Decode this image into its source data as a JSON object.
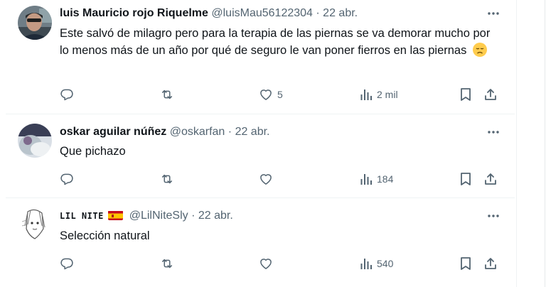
{
  "colors": {
    "text": "#0f1419",
    "secondary": "#536471",
    "divider": "#eff3f4",
    "background": "#ffffff"
  },
  "tweets": [
    {
      "name": "luis Mauricio rojo Riquelme",
      "handle": "@luisMau56122304",
      "separator": "·",
      "date": "22 abr.",
      "text": "Este salvó de milagro pero para la terapia de las piernas se va demorar mucho por lo menos más de un año por qué de seguro le van poner fierros en las piernas",
      "emoji": "disappointed-face",
      "likes": "5",
      "views": "2 mil"
    },
    {
      "name": "oskar aguilar núñez",
      "handle": "@oskarfan",
      "separator": "·",
      "date": "22 abr.",
      "text": "Que pichazo",
      "likes": "",
      "views": "184"
    },
    {
      "name": "LIL NITE",
      "flag": "spain-flag",
      "handle": "@LilNiteSly",
      "separator": "·",
      "date": "22 abr.",
      "text": "Selección natural",
      "likes": "",
      "views": "540"
    }
  ],
  "icons": {
    "more": "more-horizontal-icon",
    "reply": "reply-icon",
    "retweet": "retweet-icon",
    "like": "heart-icon",
    "views": "views-chart-icon",
    "bookmark": "bookmark-icon",
    "share": "share-icon"
  }
}
